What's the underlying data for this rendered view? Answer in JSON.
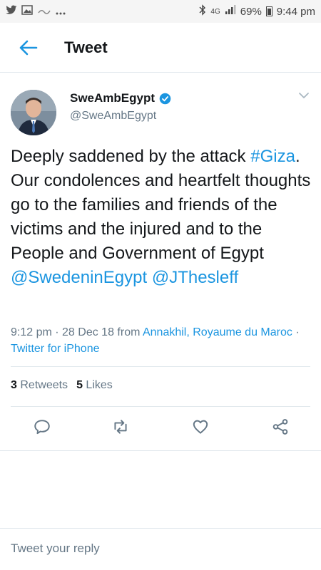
{
  "status_bar": {
    "network": "4G",
    "battery": "69%",
    "time": "9:44 pm"
  },
  "header": {
    "title": "Tweet"
  },
  "tweet": {
    "display_name": "SweAmbEgypt",
    "handle": "@SweAmbEgypt",
    "text_parts": {
      "p1": "Deeply saddened by the attack ",
      "hashtag": "#Giza",
      "p2": ". Our condolences and heartfelt thoughts go to the families and friends of the victims and the injured and to the People and Government of Egypt ",
      "mention1": "@SwedeninEgypt",
      "space": " ",
      "mention2": "@JThesleff"
    },
    "meta": {
      "timestamp": "9:12 pm · 28 Dec 18 from ",
      "location": "Annakhil, Royaume du Maroc",
      "sep": " · ",
      "client": "Twitter for iPhone"
    },
    "stats": {
      "retweets_count": "3",
      "retweets_label": "Retweets",
      "likes_count": "5",
      "likes_label": "Likes"
    }
  },
  "reply": {
    "placeholder": "Tweet your reply"
  },
  "colors": {
    "accent": "#1b95e0",
    "secondary_text": "#657786",
    "divider": "#e1e8ed"
  }
}
